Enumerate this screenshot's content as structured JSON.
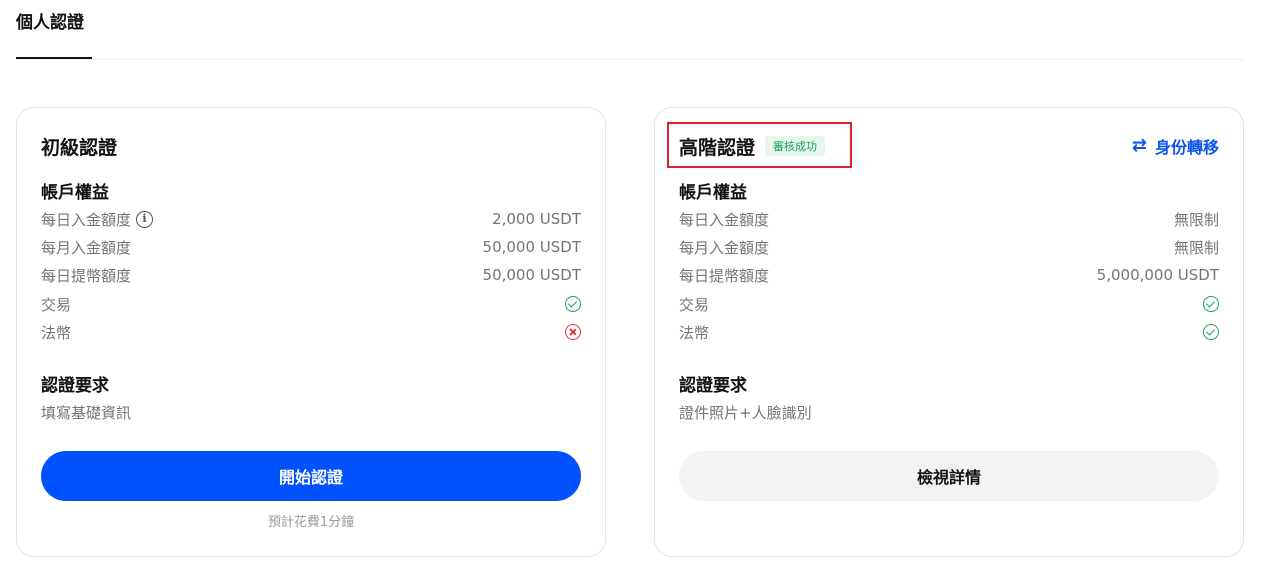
{
  "tabs": {
    "active": "個人認證"
  },
  "basic": {
    "title": "初級認證",
    "benefits_title": "帳戶權益",
    "rows": [
      {
        "label": "每日入金額度",
        "value": "2,000 USDT"
      },
      {
        "label": "每月入金額度",
        "value": "50,000 USDT"
      },
      {
        "label": "每日提幣額度",
        "value": "50,000 USDT"
      },
      {
        "label": "交易",
        "status": "check"
      },
      {
        "label": "法幣",
        "status": "cross"
      }
    ],
    "requirements_title": "認證要求",
    "requirements": "填寫基礎資訊",
    "button": "開始認證",
    "note": "預計花費1分鐘"
  },
  "advanced": {
    "title": "高階認證",
    "badge": "審核成功",
    "transfer_label": "身份轉移",
    "benefits_title": "帳戶權益",
    "rows": [
      {
        "label": "每日入金額度",
        "value": "無限制"
      },
      {
        "label": "每月入金額度",
        "value": "無限制"
      },
      {
        "label": "每日提幣額度",
        "value": "5,000,000 USDT"
      },
      {
        "label": "交易",
        "status": "check"
      },
      {
        "label": "法幣",
        "status": "check"
      }
    ],
    "requirements_title": "認證要求",
    "requirements": "證件照片+人臉識別",
    "button": "檢視詳情"
  },
  "icons": {
    "info": "info-icon",
    "transfer": "swap-arrows-icon",
    "check": "check-circle-icon",
    "cross": "cross-circle-icon"
  },
  "colors": {
    "primary": "#0052ff",
    "success": "#1aa35a",
    "error": "#e0323c",
    "highlight": "#e0202a"
  }
}
